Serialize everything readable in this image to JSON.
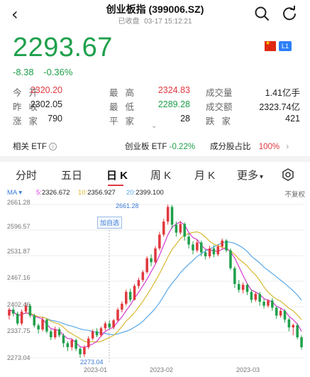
{
  "nav": {
    "back_glyph": "‹",
    "title": "创业板指 (399006.SZ)",
    "status": "已收盘",
    "datetime": "03-17 15:12:21",
    "icons": [
      "back-icon",
      "search-icon",
      "refresh-icon"
    ]
  },
  "quote": {
    "price": "2293.67",
    "change": "-8.38",
    "change_pct": "-0.36%",
    "badge": "L1",
    "colors": {
      "up": "#e0393e",
      "down": "#1fa04b"
    }
  },
  "stats": [
    {
      "label": "今开",
      "value": "2320.20",
      "color": "red"
    },
    {
      "label": "最高",
      "value": "2324.83",
      "color": "red"
    },
    {
      "label": "成交量",
      "value": "1.41亿手",
      "color": "dark"
    },
    {
      "label": "昨收",
      "value": "2302.05",
      "color": "dark"
    },
    {
      "label": "最低",
      "value": "2289.28",
      "color": "green"
    },
    {
      "label": "成交额",
      "value": "2323.74亿",
      "color": "dark"
    },
    {
      "label": "涨家",
      "value": "790",
      "color": "dark"
    },
    {
      "label": "平家",
      "value": "28",
      "color": "dark"
    },
    {
      "label": "跌家",
      "value": "421",
      "color": "dark"
    }
  ],
  "etf": {
    "related_label": "相关 ETF",
    "etf_name": "创业板 ETF",
    "etf_change": "-0.22%",
    "component_label": "成分股占比",
    "component_value": "100%"
  },
  "tabs": [
    "分时",
    "五日",
    "日 K",
    "周 K",
    "月 K",
    "更多"
  ],
  "active_tab": "日 K",
  "ma": {
    "title": "MA",
    "ma5_label": "5:",
    "ma5": "2326.672",
    "ma10_label": "10:",
    "ma10": "2356.927",
    "ma20_label": "20:",
    "ma20": "2399.100",
    "fq": "不复权",
    "colors": {
      "ma5": "#d63ad0",
      "ma10": "#d9b832",
      "ma20": "#58a8ea"
    }
  },
  "chart_data": {
    "type": "candlestick",
    "y_ticks": [
      "2661.28",
      "2596.57",
      "2531.87",
      "2467.16",
      "2402.46",
      "2337.75",
      "2273.04"
    ],
    "ylim": [
      2273.04,
      2661.28
    ],
    "x_ticks": [
      "2023-01",
      "2023-02",
      "2023-03"
    ],
    "max_label": "2661.28",
    "min_label": "2273.04",
    "annotation": "加自选",
    "candles": [
      [
        2380,
        2395,
        2370,
        2400
      ],
      [
        2395,
        2385,
        2378,
        2402
      ],
      [
        2385,
        2360,
        2355,
        2390
      ],
      [
        2360,
        2390,
        2355,
        2395
      ],
      [
        2390,
        2405,
        2385,
        2412
      ],
      [
        2405,
        2380,
        2375,
        2410
      ],
      [
        2380,
        2355,
        2350,
        2385
      ],
      [
        2355,
        2345,
        2335,
        2360
      ],
      [
        2345,
        2370,
        2340,
        2376
      ],
      [
        2370,
        2340,
        2335,
        2372
      ],
      [
        2340,
        2325,
        2318,
        2345
      ],
      [
        2325,
        2345,
        2320,
        2352
      ],
      [
        2345,
        2330,
        2325,
        2350
      ],
      [
        2330,
        2310,
        2300,
        2335
      ],
      [
        2310,
        2300,
        2290,
        2315
      ],
      [
        2300,
        2318,
        2292,
        2322
      ],
      [
        2318,
        2296,
        2290,
        2322
      ],
      [
        2296,
        2282,
        2273,
        2300
      ],
      [
        2282,
        2300,
        2275,
        2305
      ],
      [
        2300,
        2322,
        2295,
        2328
      ],
      [
        2322,
        2340,
        2318,
        2345
      ],
      [
        2340,
        2330,
        2325,
        2348
      ],
      [
        2330,
        2348,
        2326,
        2352
      ],
      [
        2348,
        2360,
        2342,
        2365
      ],
      [
        2360,
        2350,
        2345,
        2368
      ],
      [
        2350,
        2368,
        2345,
        2372
      ],
      [
        2368,
        2395,
        2365,
        2400
      ],
      [
        2395,
        2410,
        2388,
        2416
      ],
      [
        2410,
        2440,
        2405,
        2446
      ],
      [
        2440,
        2420,
        2414,
        2448
      ],
      [
        2420,
        2455,
        2418,
        2460
      ],
      [
        2455,
        2470,
        2448,
        2476
      ],
      [
        2470,
        2490,
        2465,
        2495
      ],
      [
        2490,
        2525,
        2486,
        2530
      ],
      [
        2525,
        2515,
        2505,
        2535
      ],
      [
        2515,
        2550,
        2512,
        2556
      ],
      [
        2550,
        2585,
        2545,
        2592
      ],
      [
        2585,
        2618,
        2580,
        2625
      ],
      [
        2618,
        2655,
        2610,
        2661
      ],
      [
        2655,
        2610,
        2600,
        2660
      ],
      [
        2610,
        2590,
        2580,
        2618
      ],
      [
        2590,
        2612,
        2585,
        2620
      ],
      [
        2612,
        2580,
        2570,
        2616
      ],
      [
        2580,
        2560,
        2550,
        2588
      ],
      [
        2560,
        2545,
        2535,
        2568
      ],
      [
        2545,
        2565,
        2540,
        2572
      ],
      [
        2565,
        2540,
        2530,
        2570
      ],
      [
        2540,
        2530,
        2522,
        2548
      ],
      [
        2530,
        2550,
        2525,
        2556
      ],
      [
        2550,
        2535,
        2528,
        2558
      ],
      [
        2535,
        2555,
        2530,
        2560
      ],
      [
        2555,
        2570,
        2548,
        2575
      ],
      [
        2570,
        2545,
        2540,
        2574
      ],
      [
        2545,
        2500,
        2495,
        2550
      ],
      [
        2500,
        2460,
        2450,
        2505
      ],
      [
        2460,
        2445,
        2438,
        2470
      ],
      [
        2445,
        2458,
        2436,
        2464
      ],
      [
        2458,
        2440,
        2432,
        2462
      ],
      [
        2440,
        2420,
        2412,
        2446
      ],
      [
        2420,
        2435,
        2415,
        2440
      ],
      [
        2435,
        2415,
        2405,
        2440
      ],
      [
        2415,
        2405,
        2398,
        2422
      ],
      [
        2405,
        2418,
        2400,
        2422
      ],
      [
        2418,
        2400,
        2392,
        2425
      ],
      [
        2400,
        2380,
        2372,
        2405
      ],
      [
        2380,
        2392,
        2375,
        2398
      ],
      [
        2392,
        2370,
        2362,
        2396
      ],
      [
        2370,
        2350,
        2340,
        2375
      ],
      [
        2350,
        2356,
        2330,
        2360
      ],
      [
        2356,
        2325,
        2320,
        2360
      ],
      [
        2325,
        2300,
        2294,
        2330
      ]
    ]
  }
}
